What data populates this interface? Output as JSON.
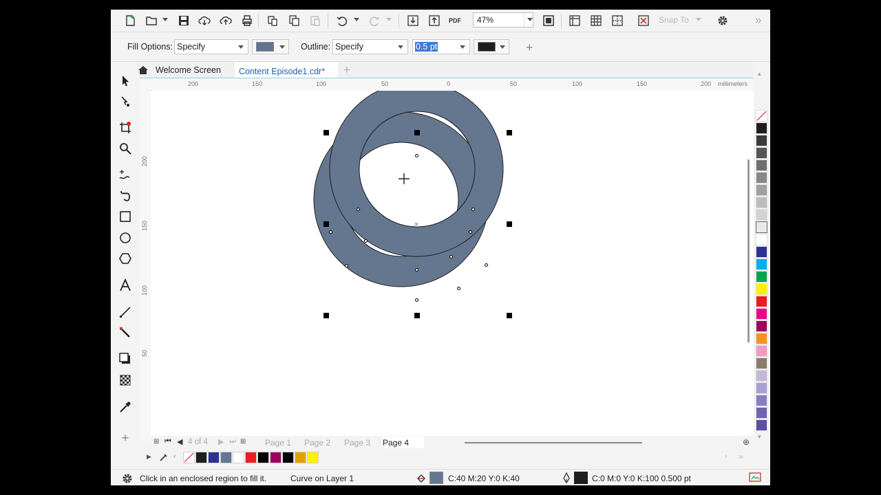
{
  "toolbar": {
    "zoom_value": "47%",
    "snap_label": "Snap To",
    "pdf_label": "PDF"
  },
  "property_bar": {
    "fill_label": "Fill Options:",
    "fill_value": "Specify",
    "fill_color": "#5f7591",
    "outline_label": "Outline:",
    "outline_value": "Specify",
    "outline_width": "0.5 pt",
    "outline_color": "#1e1e1e"
  },
  "tabs": [
    {
      "label": "Welcome Screen"
    },
    {
      "label": "Content Episode1.cdr*"
    }
  ],
  "ruler": {
    "unit": "millimeters",
    "h_labels": [
      "200",
      "150",
      "100",
      "50",
      "0",
      "50",
      "100",
      "150",
      "200"
    ],
    "v_labels": [
      "200",
      "150",
      "100",
      "50"
    ]
  },
  "pages": {
    "counter": "4 of 4",
    "tabs": [
      "Page 1",
      "Page 2",
      "Page 3",
      "Page 4"
    ],
    "active": "Page 4"
  },
  "status": {
    "hint": "Click in an enclosed region to fill it.",
    "object": "Curve on Layer 1",
    "fill_info": "C:40 M:20 Y:0 K:40",
    "outline_info": "C:0 M:0 Y:0 K:100  0.500 pt"
  },
  "colors": {
    "ring_fill": "#65768f",
    "accent": "#1a5fb4",
    "palette": [
      "#1e1e1e",
      "#3a3a3a",
      "#555555",
      "#6e6e6e",
      "#878787",
      "#a0a0a0",
      "#bcbcbc",
      "#d2d2d2",
      "#e8e8e8",
      "#ffffff",
      "#2e3192",
      "#00aeef",
      "#00a651",
      "#fff200",
      "#ed1c24",
      "#ec008c",
      "#9e005d",
      "#f7941d",
      "#f49ac1",
      "#8b7d6b",
      "#c8b6d6",
      "#a99fd1",
      "#8a7cc2",
      "#6c63b5",
      "#5a4fa6"
    ],
    "doc_palette": [
      "#1e1e1e",
      "#2e3192",
      "#65768f",
      "#ffffff",
      "#ed1c24",
      "#000000",
      "#9e005d",
      "#000000",
      "#e0a000",
      "#fff200"
    ]
  },
  "icons": {
    "tools": [
      "pick-tool-icon",
      "shape-tool-icon",
      "crop-tool-icon",
      "zoom-tool-icon",
      "freehand-tool-icon",
      "bezier-tool-icon",
      "rectangle-tool-icon",
      "ellipse-tool-icon",
      "polygon-tool-icon",
      "text-tool-icon",
      "line-tool-icon",
      "connector-tool-icon",
      "drop-shadow-tool-icon",
      "transparency-tool-icon",
      "eyedropper-tool-icon",
      "add-tool-icon"
    ]
  }
}
